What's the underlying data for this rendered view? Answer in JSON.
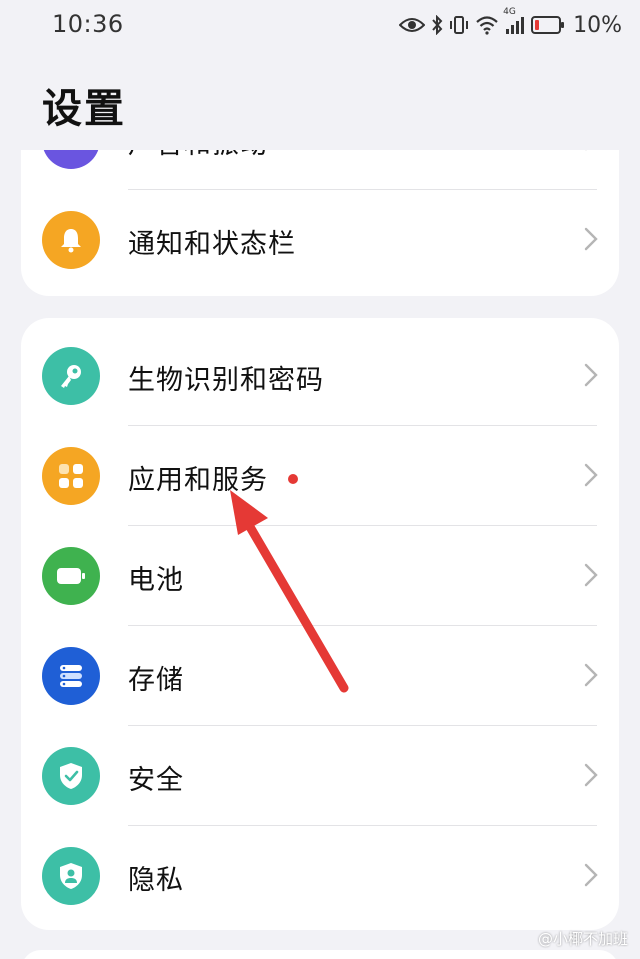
{
  "status_bar": {
    "time": "10:36",
    "battery_text": "10%",
    "network_label": "4G",
    "icons": [
      "eye-icon",
      "bluetooth-icon",
      "vibrate-icon",
      "wifi-icon",
      "signal-icon",
      "battery-icon"
    ]
  },
  "page": {
    "title": "设置"
  },
  "sections": [
    {
      "items": [
        {
          "label": "声音和振动",
          "icon": "sound-icon",
          "color": "#6a55e0"
        },
        {
          "label": "通知和状态栏",
          "icon": "bell-icon",
          "color": "#f5a623"
        }
      ]
    },
    {
      "items": [
        {
          "label": "生物识别和密码",
          "icon": "key-icon",
          "color": "#3dbfa6"
        },
        {
          "label": "应用和服务",
          "icon": "apps-icon",
          "color": "#f5a623",
          "badge": "red-dot"
        },
        {
          "label": "电池",
          "icon": "battery-icon",
          "color": "#3fb24f"
        },
        {
          "label": "存储",
          "icon": "storage-icon",
          "color": "#1f5fd6"
        },
        {
          "label": "安全",
          "icon": "shield-check-icon",
          "color": "#3dbfa6"
        },
        {
          "label": "隐私",
          "icon": "privacy-icon",
          "color": "#3dbfa6"
        }
      ]
    }
  ],
  "annotation": {
    "arrow_color": "#e53935"
  },
  "watermark": {
    "text": "@小椰不加班"
  }
}
